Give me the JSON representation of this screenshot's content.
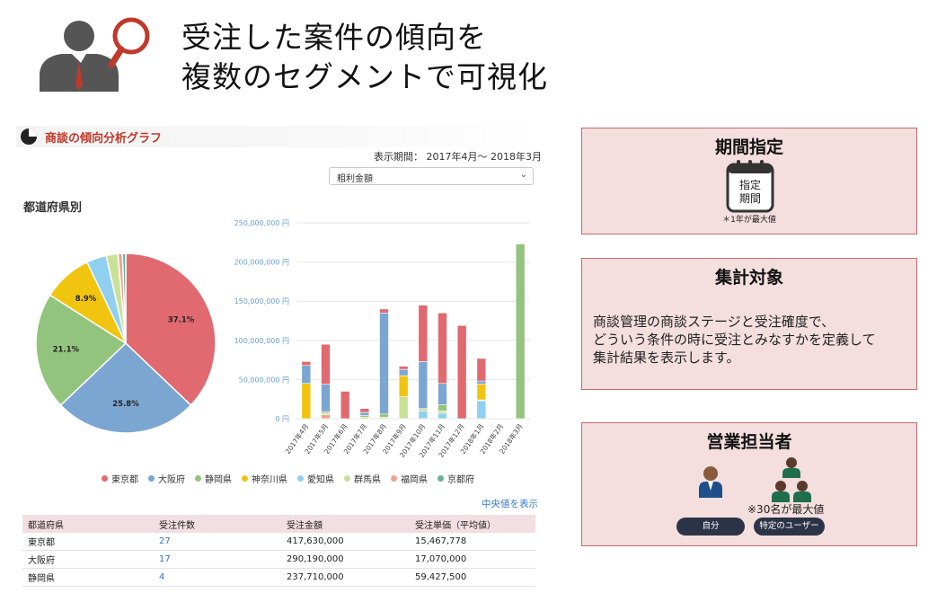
{
  "headline": {
    "line1": "受注した案件の傾向を",
    "line2": "複数のセグメントで可視化"
  },
  "panel": {
    "title": "商談の傾向分析グラフ",
    "period_label": "表示期間： 2017年4月～ 2018年3月",
    "metric_select": {
      "value": "粗利金額"
    },
    "pie_heading": "都道府県別",
    "median_link": "中央値を表示"
  },
  "legend": [
    {
      "name": "東京都",
      "color": "#e06a70"
    },
    {
      "name": "大阪府",
      "color": "#7ba6d1"
    },
    {
      "name": "静岡県",
      "color": "#93c47d"
    },
    {
      "name": "神奈川県",
      "color": "#f1c40f"
    },
    {
      "name": "愛知県",
      "color": "#8fd0f0"
    },
    {
      "name": "群馬県",
      "color": "#c9e196"
    },
    {
      "name": "福岡県",
      "color": "#f0a090"
    },
    {
      "name": "京都府",
      "color": "#6bae9a"
    }
  ],
  "chart_data": [
    {
      "type": "pie",
      "title": "都道府県別",
      "categories": [
        "東京都",
        "大阪府",
        "静岡県",
        "神奈川県",
        "愛知県",
        "群馬県",
        "福岡県",
        "京都府"
      ],
      "values": [
        37.1,
        25.8,
        21.1,
        8.9,
        3.6,
        2.1,
        0.8,
        0.6
      ],
      "labels": [
        "37.1%",
        "25.8%",
        "21.1%",
        "8.9%"
      ]
    },
    {
      "type": "bar",
      "stacked": true,
      "categories": [
        "2017年4月",
        "2017年5月",
        "2017年6月",
        "2017年7月",
        "2017年8月",
        "2017年9月",
        "2017年10月",
        "2017年11月",
        "2017年12月",
        "2018年1月",
        "2018年2月",
        "2018年3月"
      ],
      "ylim": [
        0,
        250000000
      ],
      "y_ticks": [
        "0 円",
        "50,000,000 円",
        "100,000,000 円",
        "150,000,000 円",
        "200,000,000 円",
        "250,000,000 円"
      ],
      "series": [
        {
          "name": "愛知県",
          "values": [
            0,
            0,
            0,
            0,
            0,
            0,
            10000000,
            7000000,
            0,
            23000000,
            0,
            0
          ]
        },
        {
          "name": "福岡県",
          "values": [
            0,
            5000000,
            0,
            0,
            0,
            0,
            0,
            0,
            0,
            0,
            0,
            0
          ]
        },
        {
          "name": "群馬県",
          "values": [
            0,
            2000000,
            0,
            2000000,
            2000000,
            28000000,
            3000000,
            3000000,
            0,
            1000000,
            0,
            0
          ]
        },
        {
          "name": "神奈川県",
          "values": [
            45000000,
            0,
            0,
            0,
            0,
            27000000,
            0,
            0,
            0,
            20000000,
            0,
            0
          ]
        },
        {
          "name": "静岡県",
          "values": [
            0,
            2000000,
            0,
            2000000,
            4000000,
            0,
            0,
            8000000,
            0,
            0,
            0,
            223000000
          ]
        },
        {
          "name": "大阪府",
          "values": [
            23000000,
            35000000,
            0,
            4000000,
            129000000,
            8000000,
            60000000,
            27000000,
            0,
            4000000,
            0,
            0
          ]
        },
        {
          "name": "東京都",
          "values": [
            5000000,
            51000000,
            35000000,
            5000000,
            5000000,
            4000000,
            72000000,
            90000000,
            119000000,
            29000000,
            0,
            0
          ]
        }
      ]
    }
  ],
  "table": {
    "headers": [
      "都道府県",
      "受注件数",
      "受注金額",
      "受注単価（平均値）"
    ],
    "rows": [
      [
        "東京都",
        "27",
        "417,630,000",
        "15,467,778"
      ],
      [
        "大阪府",
        "17",
        "290,190,000",
        "17,070,000"
      ],
      [
        "静岡県",
        "4",
        "237,710,000",
        "59,427,500"
      ]
    ]
  },
  "cards": {
    "period": {
      "title": "期間指定",
      "calendar_line1": "指定",
      "calendar_line2": "期間",
      "note": "＊1年が最大値"
    },
    "target": {
      "title": "集計対象",
      "desc_line1": "商談管理の商談ステージと受注確度で、",
      "desc_line2": "どういう条件の時に受注とみなすかを定義して",
      "desc_line3": "集計結果を表示します。"
    },
    "staff": {
      "title": "営業担当者",
      "note": "※30名が最大値",
      "btn_self": "自分",
      "btn_specific": "特定のユーザー"
    }
  }
}
